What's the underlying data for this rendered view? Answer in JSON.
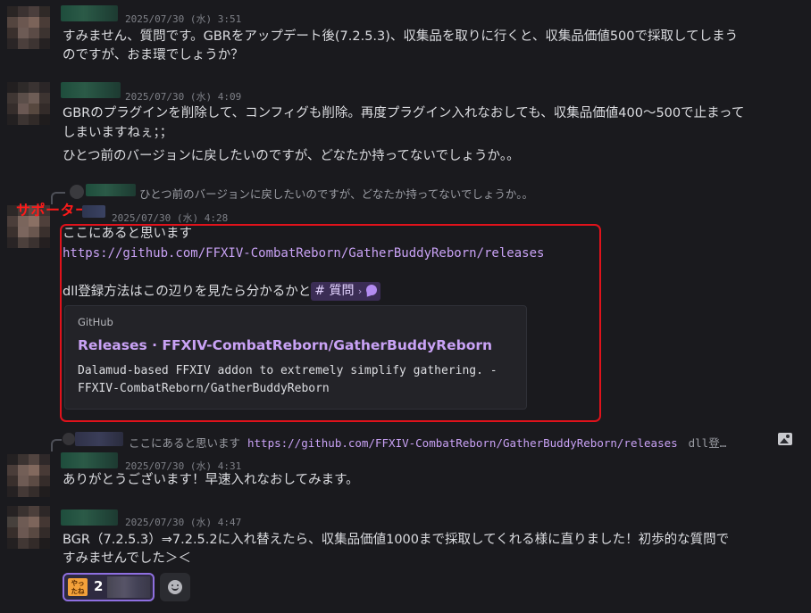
{
  "messages": [
    {
      "timestamp": "2025/07/30 (水) 3:51",
      "lines": [
        "すみません、質問です。GBRをアップデート後(7.2.5.3)、収集品を取りに行くと、収集品価値500で採取してしまう",
        "のですが、おま環でしょうか？"
      ]
    },
    {
      "timestamp": "2025/07/30 (水) 4:09",
      "lines": [
        "GBRのプラグインを削除して、コンフィグも削除。再度プラグイン入れなおしても、収集品価値400～500で止まって",
        "しまいますねぇ；；",
        "ひとつ前のバージョンに戻したいのですが、どなたか持ってないでしょうか｡｡"
      ]
    },
    {
      "reply_preview": "ひとつ前のバージョンに戻したいのですが、どなたか持ってないでしょうか｡｡",
      "annotation": "サポーター",
      "timestamp": "2025/07/30 (水) 4:28",
      "line1": "ここにあると思います",
      "link": "https://github.com/FFXIV-CombatReborn/GatherBuddyReborn/releases",
      "line3": "dll登録方法はこの辺りを見たら分かるかと",
      "channel_chip": "# 質問",
      "channel_chevron": "›",
      "embed": {
        "provider": "GitHub",
        "title": "Releases · FFXIV-CombatReborn/GatherBuddyReborn",
        "desc_line1": "Dalamud-based FFXIV addon to extremely simplify gathering. -",
        "desc_line2": "FFXIV-CombatReborn/GatherBuddyReborn"
      }
    },
    {
      "reply_preview_text": "ここにあると思います",
      "reply_preview_link": "https://github.com/FFXIV-CombatReborn/GatherBuddyReborn/releases",
      "reply_preview_tail": "dll登…",
      "timestamp": "2025/07/30 (水) 4:31",
      "lines": [
        "ありがとうございます！早速入れなおしてみます。"
      ]
    },
    {
      "timestamp": "2025/07/30 (水) 4:47",
      "lines": [
        "BGR（7.2.5.3）⇒7.2.5.2に入れ替えたら、収集品価値1000まで採取してくれる様に直りました！初歩的な質問で",
        "すみませんでした＞＜"
      ],
      "reaction": {
        "emoji_text": "やったね",
        "count": "2"
      }
    }
  ],
  "colors": {
    "background": "#1a1a1e",
    "link": "#c9a2f5",
    "highlight_box": "#e0121b",
    "annotation": "#ff1a1a"
  },
  "icons": {
    "image_attachment": "image-icon",
    "channel_bubble": "chat-bubble-icon",
    "add_reaction": "smiley-icon"
  }
}
